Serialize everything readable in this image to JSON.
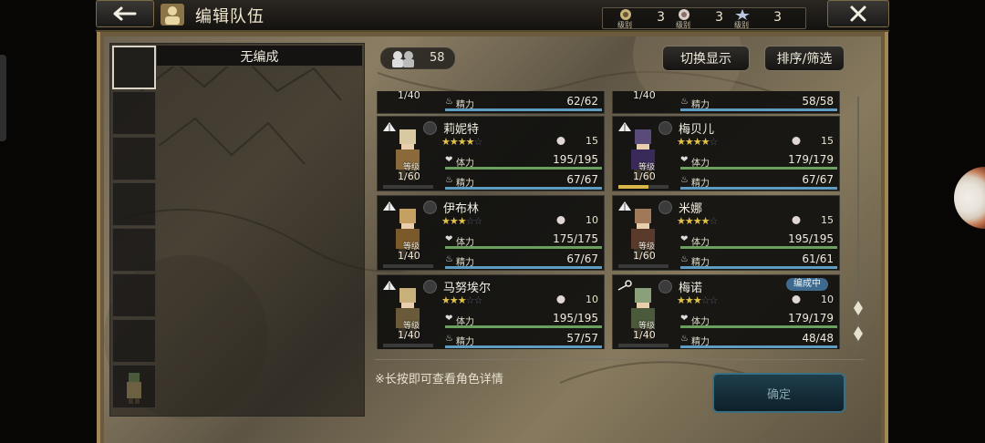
{
  "header": {
    "back_icon": "back-arrow-icon",
    "title": "编辑队伍",
    "close_icon": "close-icon",
    "ranks": [
      {
        "icon": "rank-gold-icon",
        "label": "级别",
        "count": "3"
      },
      {
        "icon": "rank-silver-icon",
        "label": "级别",
        "count": "3"
      },
      {
        "icon": "rank-star-icon",
        "label": "级别",
        "count": "3"
      }
    ]
  },
  "left_panel": {
    "formation_label": "无编成"
  },
  "toolbar": {
    "unit_count": "58",
    "toggle_display": "切换显示",
    "sort_filter": "排序/筛选"
  },
  "partial_row": [
    {
      "level": "1/40",
      "sp_label": "精力",
      "sp": "62/62"
    },
    {
      "level": "1/40",
      "sp_label": "精力",
      "sp": "58/58"
    }
  ],
  "characters": [
    {
      "name": "莉妮特",
      "stars": 4,
      "rank": "15",
      "level_label": "等级",
      "level": "1/60",
      "hp_label": "体力",
      "hp": "195/195",
      "sp_label": "精力",
      "sp": "67/67",
      "tag": "",
      "level_progress": 0.0
    },
    {
      "name": "梅贝儿",
      "stars": 4,
      "rank": "15",
      "level_label": "等级",
      "level": "1/60",
      "hp_label": "体力",
      "hp": "179/179",
      "sp_label": "精力",
      "sp": "67/67",
      "tag": "",
      "level_progress": 0.6
    },
    {
      "name": "伊布林",
      "stars": 3,
      "rank": "10",
      "level_label": "等级",
      "level": "1/40",
      "hp_label": "体力",
      "hp": "175/175",
      "sp_label": "精力",
      "sp": "67/67",
      "tag": "",
      "level_progress": 0.0
    },
    {
      "name": "米娜",
      "stars": 4,
      "rank": "15",
      "level_label": "等级",
      "level": "1/60",
      "hp_label": "体力",
      "hp": "195/195",
      "sp_label": "精力",
      "sp": "61/61",
      "tag": "",
      "level_progress": 0.0
    },
    {
      "name": "马努埃尔",
      "stars": 3,
      "rank": "10",
      "level_label": "等级",
      "level": "1/40",
      "hp_label": "体力",
      "hp": "195/195",
      "sp_label": "精力",
      "sp": "57/57",
      "tag": "",
      "level_progress": 0.0
    },
    {
      "name": "梅诺",
      "stars": 3,
      "rank": "10",
      "level_label": "等级",
      "level": "1/40",
      "hp_label": "体力",
      "hp": "179/179",
      "sp_label": "精力",
      "sp": "48/48",
      "tag": "编成中",
      "level_progress": 0.0
    }
  ],
  "footer": {
    "hint": "※长按即可查看角色详情",
    "confirm": "确定"
  },
  "colors": {
    "hp_bar": "#6aa05e",
    "sp_bar": "#5f9cc1",
    "star_on": "#e2c24a",
    "star_off": "#575a6c",
    "tag_bg": "#3d6a8e",
    "confirm_bg": "#1d3e4c"
  }
}
